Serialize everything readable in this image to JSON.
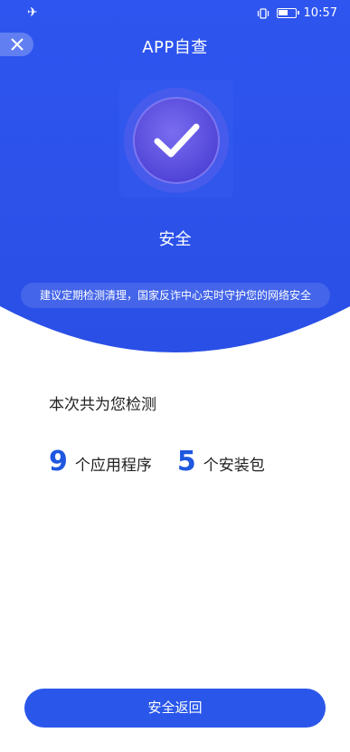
{
  "status_bar": {
    "time": "10:57",
    "battery_level": 0.6
  },
  "header": {
    "title": "APP自查",
    "close_icon": "close-icon"
  },
  "result": {
    "status": "安全",
    "tip": "建议定期检测清理，国家反诈中心实时守护您的网络安全"
  },
  "summary": {
    "label": "本次共为您检测",
    "apps_count": "9",
    "apps_unit": "个应用程序",
    "packages_count": "5",
    "packages_unit": "个安装包"
  },
  "footer": {
    "return_label": "安全返回"
  },
  "colors": {
    "primary": "#2a57ea",
    "accent_number": "#1f57e0",
    "badge": "#5a4fe0"
  }
}
